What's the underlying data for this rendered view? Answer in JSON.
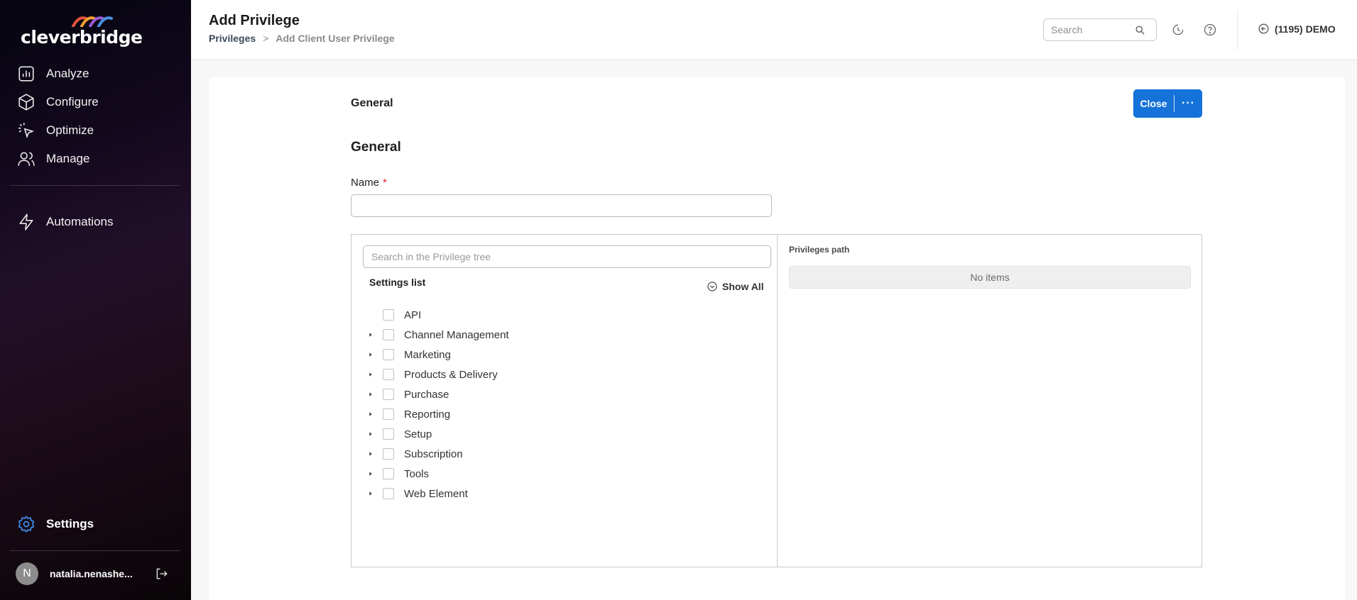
{
  "sidebar": {
    "logo_text": "cleverbridge",
    "nav": [
      {
        "label": "Analyze",
        "icon": "chart-bar-icon"
      },
      {
        "label": "Configure",
        "icon": "cube-icon"
      },
      {
        "label": "Optimize",
        "icon": "cursor-sparkle-icon"
      },
      {
        "label": "Manage",
        "icon": "users-icon"
      }
    ],
    "automations": {
      "label": "Automations",
      "icon": "lightning-icon"
    },
    "settings": {
      "label": "Settings",
      "icon": "gear-icon"
    },
    "user": {
      "initial": "N",
      "name": "natalia.nenashe..."
    }
  },
  "header": {
    "title": "Add Privilege",
    "breadcrumb": {
      "link": "Privileges",
      "separator": ">",
      "current": "Add Client User Privilege"
    },
    "search_placeholder": "Search",
    "account_label": "(1195) DEMO"
  },
  "form": {
    "section_tab": "General",
    "close_label": "Close",
    "more_label": "···",
    "section_title": "General",
    "name_label": "Name",
    "required_mark": "*",
    "name_value": ""
  },
  "tree": {
    "search_placeholder": "Search in the Privilege tree",
    "list_label": "Settings list",
    "show_all_label": "Show All",
    "items": [
      {
        "label": "API",
        "expandable": false
      },
      {
        "label": "Channel Management",
        "expandable": true
      },
      {
        "label": "Marketing",
        "expandable": true
      },
      {
        "label": "Products & Delivery",
        "expandable": true
      },
      {
        "label": "Purchase",
        "expandable": true
      },
      {
        "label": "Reporting",
        "expandable": true
      },
      {
        "label": "Setup",
        "expandable": true
      },
      {
        "label": "Subscription",
        "expandable": true
      },
      {
        "label": "Tools",
        "expandable": true
      },
      {
        "label": "Web Element",
        "expandable": true
      }
    ]
  },
  "path": {
    "label": "Privileges path",
    "empty_text": "No items"
  },
  "colors": {
    "accent": "#1472d9",
    "required": "#d9232e",
    "settings_icon": "#3d8eea"
  }
}
